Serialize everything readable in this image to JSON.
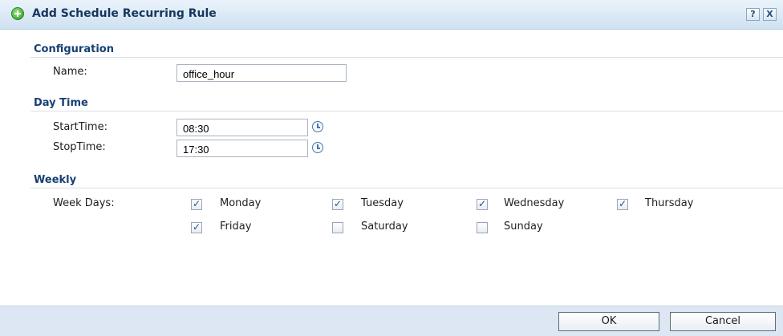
{
  "title": "Add Schedule Recurring Rule",
  "titlebar": {
    "help_label": "?",
    "close_label": "X"
  },
  "configuration": {
    "heading": "Configuration",
    "name_label": "Name:",
    "name_value": "office_hour"
  },
  "daytime": {
    "heading": "Day Time",
    "start_label": "StartTime:",
    "start_value": "08:30",
    "stop_label": "StopTime:",
    "stop_value": "17:30"
  },
  "weekly": {
    "heading": "Weekly",
    "days_label": "Week Days:",
    "days": [
      {
        "label": "Monday",
        "checked": true
      },
      {
        "label": "Tuesday",
        "checked": true
      },
      {
        "label": "Wednesday",
        "checked": true
      },
      {
        "label": "Thursday",
        "checked": true
      },
      {
        "label": "Friday",
        "checked": true
      },
      {
        "label": "Saturday",
        "checked": false
      },
      {
        "label": "Sunday",
        "checked": false
      }
    ]
  },
  "buttons": {
    "ok": "OK",
    "cancel": "Cancel"
  }
}
